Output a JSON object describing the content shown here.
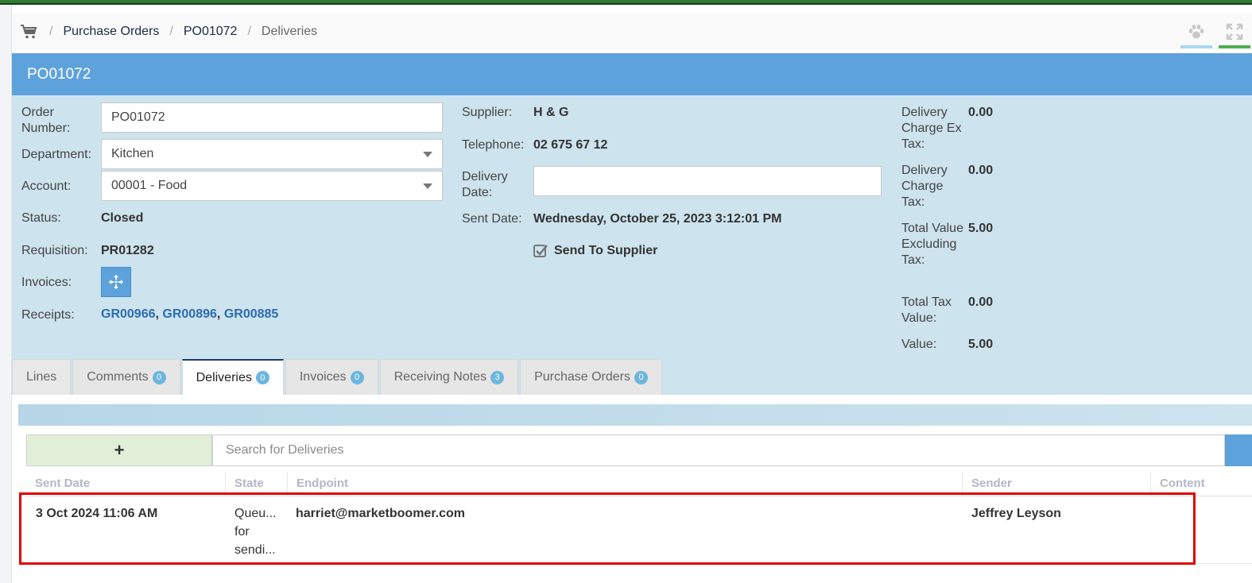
{
  "breadcrumb": {
    "items": [
      "Purchase Orders",
      "PO01072"
    ],
    "current": "Deliveries"
  },
  "icons": {
    "cart": "shopping-cart-icon",
    "paw": "paw-icon",
    "expand": "expand-icon",
    "invoices": "crosshair-move-icon",
    "send_check": "checked-checkbox-icon",
    "add": "plus-icon"
  },
  "panel": {
    "title": "PO01072"
  },
  "order": {
    "order_number_label": "Order Number:",
    "order_number_value": "PO01072",
    "department_label": "Department:",
    "department_value": "Kitchen",
    "account_label": "Account:",
    "account_value": "00001 - Food",
    "status_label": "Status:",
    "status_value": "Closed",
    "requisition_label": "Requisition:",
    "requisition_value": "PR01282",
    "invoices_label": "Invoices:",
    "receipts_label": "Receipts:",
    "receipts": [
      "GR00966",
      "GR00896",
      "GR00885"
    ],
    "receipt_separator": ","
  },
  "supplier": {
    "supplier_label": "Supplier:",
    "supplier_value": "H & G",
    "telephone_label": "Telephone:",
    "telephone_value": "02 675 67 12",
    "delivery_date_label": "Delivery Date:",
    "delivery_date_value": "",
    "sent_date_label": "Sent Date:",
    "sent_date_value": "Wednesday, October 25, 2023 3:12:01 PM",
    "send_to_supplier_label": "Send To Supplier",
    "send_to_supplier_checked": true
  },
  "totals": {
    "delivery_charge_ex_tax_label": "Delivery Charge Ex Tax:",
    "delivery_charge_ex_tax_value": "0.00",
    "delivery_charge_tax_label": "Delivery Charge Tax:",
    "delivery_charge_tax_value": "0.00",
    "total_value_excl_tax_label": "Total Value Excluding Tax:",
    "total_value_excl_tax_value": "5.00",
    "total_tax_value_label": "Total Tax Value:",
    "total_tax_value_value": "0.00",
    "value_label": "Value:",
    "value_value": "5.00"
  },
  "tabs": [
    {
      "label": "Lines",
      "count": null
    },
    {
      "label": "Comments",
      "count": "0"
    },
    {
      "label": "Deliveries",
      "count": "0",
      "active": true
    },
    {
      "label": "Invoices",
      "count": "0"
    },
    {
      "label": "Receiving Notes",
      "count": "3"
    },
    {
      "label": "Purchase Orders",
      "count": "0"
    }
  ],
  "deliveries": {
    "add_label": "+",
    "search_placeholder": "Search for Deliveries",
    "columns": [
      "Sent Date",
      "State",
      "Endpoint",
      "Sender",
      "Content"
    ],
    "rows": [
      {
        "sent_date": "3 Oct 2024 11:06 AM",
        "state_lines": [
          "Queu...",
          "for",
          "sendi..."
        ],
        "endpoint": "harriet@marketboomer.com",
        "sender": "Jeffrey Leyson",
        "content": ""
      }
    ]
  },
  "colors": {
    "top_bar": "#2e7d32",
    "panel_header": "#5ea2dc",
    "panel_body": "#cde3ee",
    "add_button": "#e1efd9",
    "badge": "#6cb6df",
    "highlight": "#e00000",
    "link": "#2b6cb0"
  }
}
